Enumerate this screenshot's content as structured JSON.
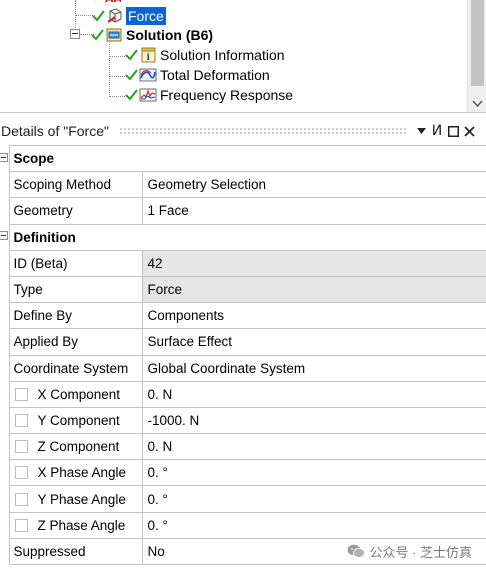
{
  "tree": {
    "items": [
      {
        "label": "Force",
        "selected": true
      },
      {
        "label": "Solution (B6)",
        "bold": true
      },
      {
        "label": "Solution Information"
      },
      {
        "label": "Total Deformation"
      },
      {
        "label": "Frequency Response"
      }
    ]
  },
  "details": {
    "title": "Details of \"Force\"",
    "pin_glyph": "И",
    "groups": [
      {
        "name": "Scope",
        "rows": [
          {
            "label": "Scoping Method",
            "value": "Geometry Selection"
          },
          {
            "label": "Geometry",
            "value": "1 Face"
          }
        ]
      },
      {
        "name": "Definition",
        "rows": [
          {
            "label": "ID (Beta)",
            "value": "42"
          },
          {
            "label": "Type",
            "value": "Force"
          },
          {
            "label": "Define By",
            "value": "Components"
          },
          {
            "label": "Applied By",
            "value": "Surface Effect"
          },
          {
            "label": "Coordinate System",
            "value": "Global Coordinate System"
          },
          {
            "label": "X Component",
            "value": "0. N"
          },
          {
            "label": "Y Component",
            "value": "-1000. N"
          },
          {
            "label": "Z Component",
            "value": "0. N"
          },
          {
            "label": "X Phase Angle",
            "value": "0. °"
          },
          {
            "label": "Y Phase Angle",
            "value": "0. °"
          },
          {
            "label": "Z Phase Angle",
            "value": "0. °"
          },
          {
            "label": "Suppressed",
            "value": "No"
          }
        ]
      }
    ]
  },
  "watermark": "公众号 · 芝士仿真",
  "colors": {
    "selection": "#0a64d2",
    "check": "#2e9c1e",
    "readonly_shade": "#e6e6e6"
  }
}
